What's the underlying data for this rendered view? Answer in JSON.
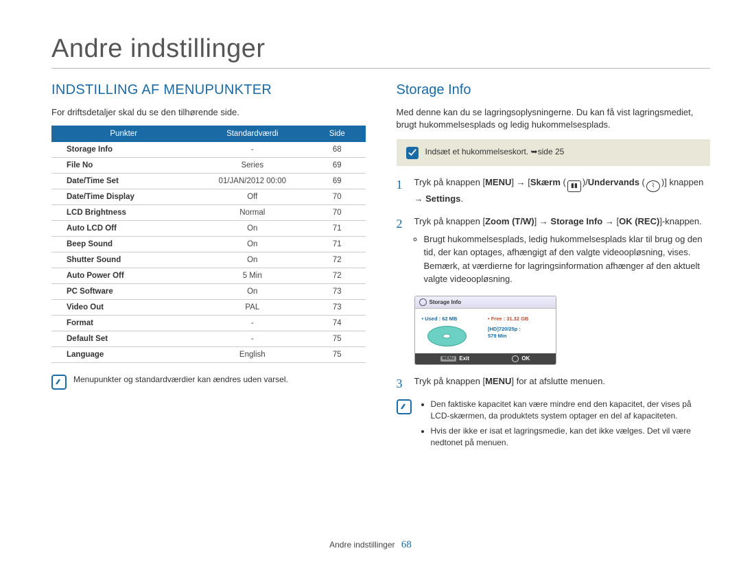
{
  "page": {
    "main_title": "Andre indstillinger",
    "footer_label": "Andre indstillinger",
    "page_number": "68"
  },
  "left": {
    "heading": "INDSTILLING AF MENUPUNKTER",
    "intro": "For driftsdetaljer skal du se den tilhørende side.",
    "table_headers": {
      "c1": "Punkter",
      "c2": "Standardværdi",
      "c3": "Side"
    },
    "rows": [
      {
        "c1": "Storage Info",
        "c2": "-",
        "c3": "68"
      },
      {
        "c1": "File No",
        "c2": "Series",
        "c3": "69"
      },
      {
        "c1": "Date/Time Set",
        "c2": "01/JAN/2012 00:00",
        "c3": "69"
      },
      {
        "c1": "Date/Time Display",
        "c2": "Off",
        "c3": "70"
      },
      {
        "c1": "LCD Brightness",
        "c2": "Normal",
        "c3": "70"
      },
      {
        "c1": "Auto LCD Off",
        "c2": "On",
        "c3": "71"
      },
      {
        "c1": "Beep Sound",
        "c2": "On",
        "c3": "71"
      },
      {
        "c1": "Shutter Sound",
        "c2": "On",
        "c3": "72"
      },
      {
        "c1": "Auto Power Off",
        "c2": "5 Min",
        "c3": "72"
      },
      {
        "c1": "PC Software",
        "c2": "On",
        "c3": "73"
      },
      {
        "c1": "Video Out",
        "c2": "PAL",
        "c3": "73"
      },
      {
        "c1": "Format",
        "c2": "-",
        "c3": "74"
      },
      {
        "c1": "Default Set",
        "c2": "-",
        "c3": "75"
      },
      {
        "c1": "Language",
        "c2": "English",
        "c3": "75"
      }
    ],
    "note": "Menupunkter og standardværdier kan ændres uden varsel."
  },
  "right": {
    "heading": "Storage Info",
    "intro": "Med denne kan du se lagringsoplysningerne. Du kan få vist lagringsmediet, brugt hukommelsesplads og ledig hukommelsesplads.",
    "insert_note": "Indsæt et hukommelseskort. ➥side 25",
    "step1_pre": "Tryk på knappen [",
    "step1_menu": "MENU",
    "step1_mid1": "] → [",
    "step1_skaerm": "Skærm",
    "step1_mid2": " (",
    "step1_mid3": ")/",
    "step1_undervands": "Undervands",
    "step1_mid4": " (",
    "step1_mid5": ")] knappen → ",
    "step1_settings": "Settings",
    "step1_end": ".",
    "step2_pre": "Tryk på knappen [",
    "step2_zoom": "Zoom (T/W)",
    "step2_a1": "] → ",
    "step2_storage": "Storage Info",
    "step2_a2": " → [",
    "step2_ok": "OK (REC)",
    "step2_end": "]-knappen.",
    "step2_bullet": "Brugt hukommelsesplads, ledig hukommelsesplads klar til brug og den tid, der kan optages, afhængigt af den valgte videoopløsning, vises. Bemærk, at værdierne for lagringsinformation afhænger af den aktuelt valgte videoopløsning.",
    "step3_pre": "Tryk på knappen [",
    "step3_menu": "MENU",
    "step3_end": "] for at afslutte menuen.",
    "notes": [
      "Den faktiske kapacitet kan være mindre end den kapacitet, der vises på LCD-skærmen, da produktets system optager en del af kapaciteten.",
      "Hvis der ikke er isat et lagringsmedie, kan det ikke vælges. Det vil være nedtonet på menuen."
    ],
    "lcd": {
      "title": "Storage Info",
      "used": "• Used : 62 MB",
      "free": "• Free : 31.32 GB",
      "res": "[HD]720/25p :",
      "time": "579 Min",
      "exit": "Exit",
      "ok": "OK"
    }
  }
}
